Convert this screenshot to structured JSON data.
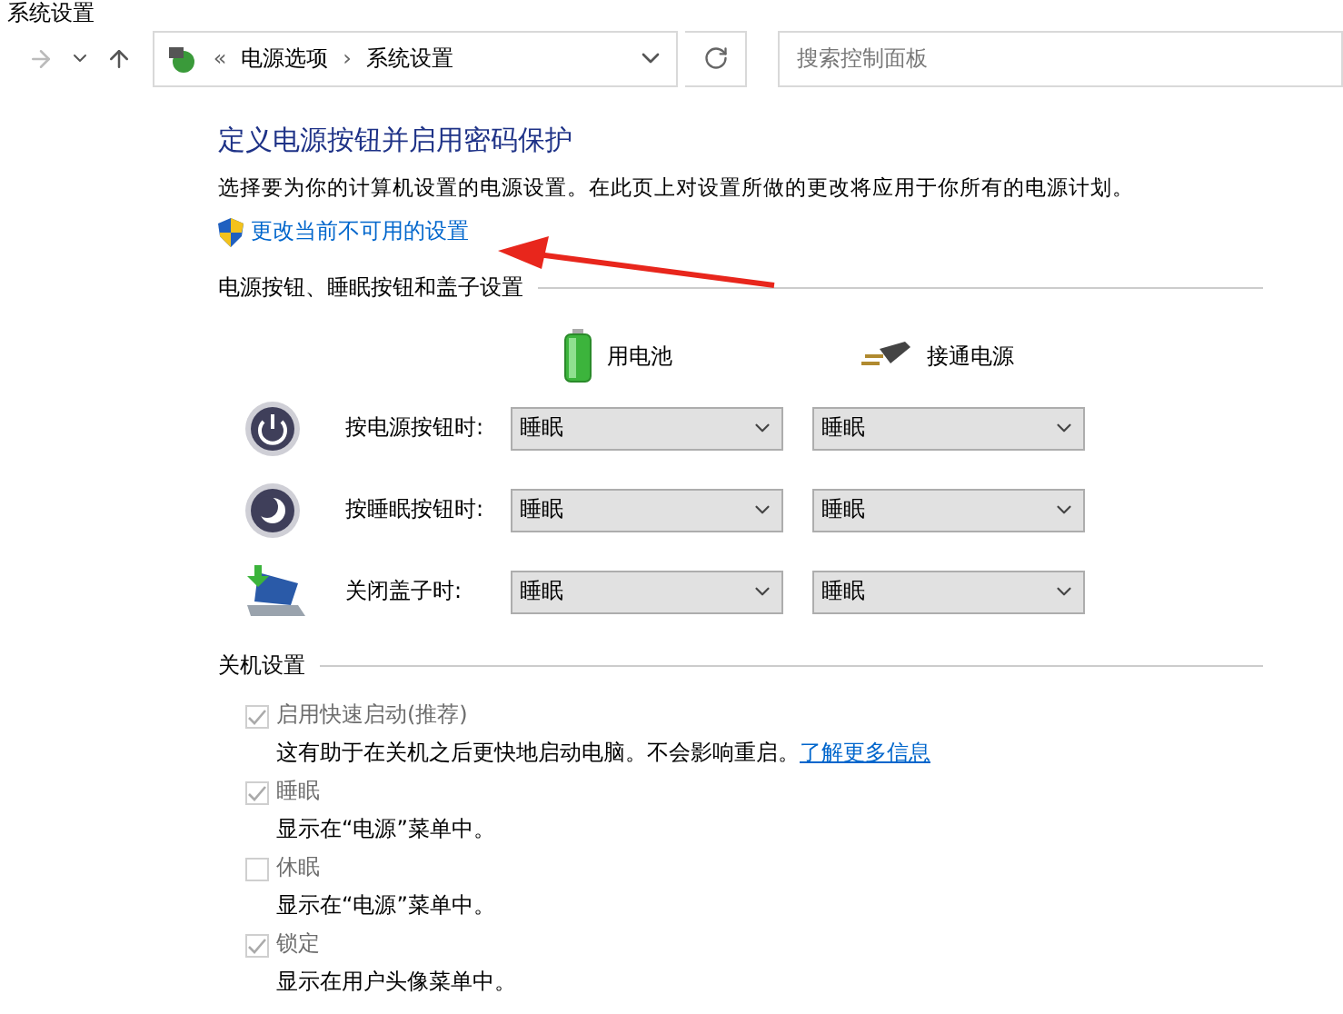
{
  "window": {
    "title": "系统设置"
  },
  "nav": {
    "breadcrumb_prefix": "«",
    "breadcrumb": [
      {
        "label": "电源选项",
        "separator": "›"
      },
      {
        "label": "系统设置"
      }
    ],
    "search": {
      "placeholder": "搜索控制面板"
    }
  },
  "heading": "定义电源按钮并启用密码保护",
  "description": "选择要为你的计算机设置的电源设置。在此页上对设置所做的更改将应用于你所有的电源计划。",
  "admin_link": "更改当前不可用的设置",
  "power_section": {
    "title": "电源按钮、睡眠按钮和盖子设置",
    "columns": [
      {
        "kind": "battery",
        "label": "用电池"
      },
      {
        "kind": "plug",
        "label": "接通电源"
      }
    ],
    "rows": [
      {
        "kind": "power",
        "label": "按电源按钮时:",
        "values": [
          "睡眠",
          "睡眠"
        ]
      },
      {
        "kind": "sleep",
        "label": "按睡眠按钮时:",
        "values": [
          "睡眠",
          "睡眠"
        ]
      },
      {
        "kind": "lid",
        "label": "关闭盖子时:",
        "values": [
          "睡眠",
          "睡眠"
        ]
      }
    ]
  },
  "shutdown_section": {
    "title": "关机设置",
    "items": [
      {
        "label": "启用快速启动(推荐)",
        "checked": true,
        "disabled": true,
        "description": "这有助于在关机之后更快地启动电脑。不会影响重启。",
        "link": "了解更多信息"
      },
      {
        "label": "睡眠",
        "checked": true,
        "disabled": true,
        "description": "显示在“电源”菜单中。"
      },
      {
        "label": "休眠",
        "checked": false,
        "disabled": true,
        "description": "显示在“电源”菜单中。"
      },
      {
        "label": "锁定",
        "checked": true,
        "disabled": true,
        "description": "显示在用户头像菜单中。"
      }
    ]
  }
}
